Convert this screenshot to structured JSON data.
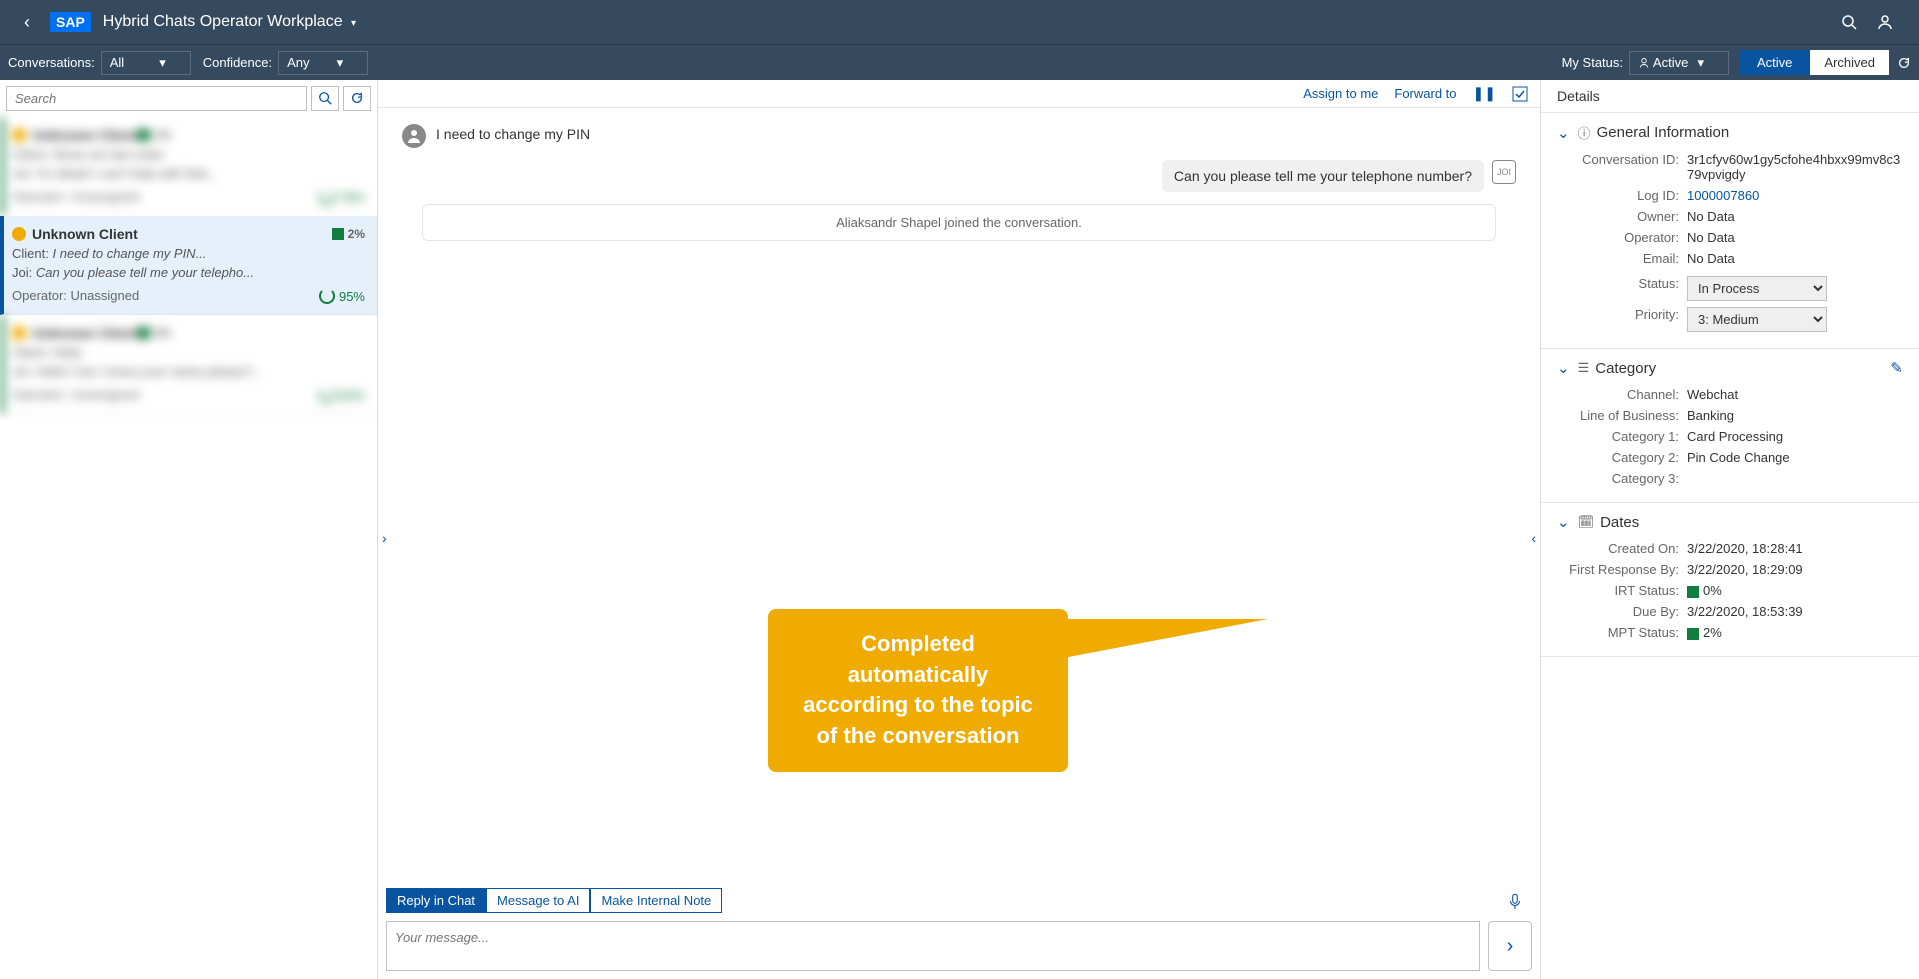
{
  "header": {
    "app_title": "Hybrid Chats Operator Workplace"
  },
  "subheader": {
    "conversations_label": "Conversations:",
    "conversations_value": "All",
    "confidence_label": "Confidence:",
    "confidence_value": "Any",
    "my_status_label": "My Status:",
    "my_status_value": "Active",
    "tab_active": "Active",
    "tab_archived": "Archived"
  },
  "search": {
    "placeholder": "Search"
  },
  "selected_conversation": {
    "title": "Unknown Client",
    "badge_percent": "2%",
    "client_label": "Client:",
    "client_text": "I need to change my PIN...",
    "joi_label": "Joi:",
    "joi_text": "Can you please tell me your telepho...",
    "operator_label": "Operator:",
    "operator_value": "Unassigned",
    "progress": "95%"
  },
  "center": {
    "assign_to_me": "Assign to me",
    "forward_to": "Forward to",
    "client_msg": "I need to change my PIN",
    "bot_msg": "Can you please tell me your telephone number?",
    "system_msg": "Aliaksandr Shapel joined the conversation.",
    "reply_tab_chat": "Reply in Chat",
    "reply_tab_ai": "Message to AI",
    "reply_tab_note": "Make Internal Note",
    "reply_placeholder": "Your message..."
  },
  "callout": {
    "text": "Completed automatically according to the topic of the conversation"
  },
  "details": {
    "title": "Details",
    "general": {
      "title": "General Information",
      "conv_id_label": "Conversation ID:",
      "conv_id_value": "3r1cfyv60w1gy5cfohe4hbxx99mv8c379vpvigdy",
      "log_id_label": "Log ID:",
      "log_id_value": "1000007860",
      "owner_label": "Owner:",
      "owner_value": "No Data",
      "operator_label": "Operator:",
      "operator_value": "No Data",
      "email_label": "Email:",
      "email_value": "No Data",
      "status_label": "Status:",
      "status_value": "In Process",
      "priority_label": "Priority:",
      "priority_value": "3: Medium"
    },
    "category": {
      "title": "Category",
      "channel_label": "Channel:",
      "channel_value": "Webchat",
      "lob_label": "Line of Business:",
      "lob_value": "Banking",
      "cat1_label": "Category 1:",
      "cat1_value": "Card Processing",
      "cat2_label": "Category 2:",
      "cat2_value": "Pin Code Change",
      "cat3_label": "Category 3:",
      "cat3_value": ""
    },
    "dates": {
      "title": "Dates",
      "created_label": "Created On:",
      "created_value": "3/22/2020, 18:28:41",
      "first_resp_label": "First Response By:",
      "first_resp_value": "3/22/2020, 18:29:09",
      "irt_label": "IRT Status:",
      "irt_value": "0%",
      "due_label": "Due By:",
      "due_value": "3/22/2020, 18:53:39",
      "mpt_label": "MPT Status:",
      "mpt_value": "2%"
    }
  }
}
